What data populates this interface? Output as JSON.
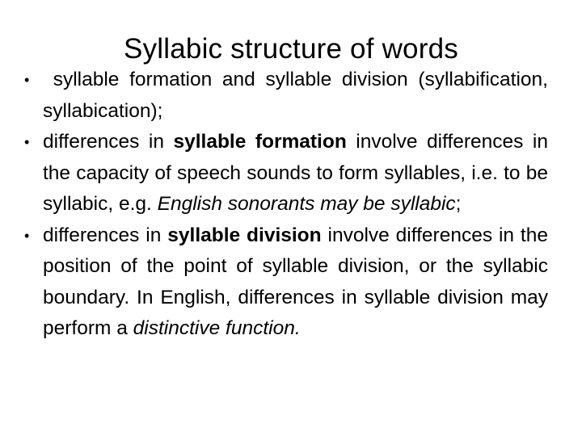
{
  "slide": {
    "title": "Syllabic structure of words",
    "bullets": [
      {
        "segments": [
          {
            "text": " syllable formation and syllable division (syllabification, syllabication);",
            "style": "normal"
          }
        ]
      },
      {
        "segments": [
          {
            "text": "differences in ",
            "style": "normal"
          },
          {
            "text": "syllable formation",
            "style": "bold"
          },
          {
            "text": " involve differences in the capacity of speech sounds to form syllables, i.e. to be syllabic, e.g. ",
            "style": "normal"
          },
          {
            "text": "English sonorants may be syllabic",
            "style": "italic"
          },
          {
            "text": ";",
            "style": "normal"
          }
        ]
      },
      {
        "segments": [
          {
            "text": "differences in ",
            "style": "normal"
          },
          {
            "text": "syllable division",
            "style": "bold"
          },
          {
            "text": " involve differences in the position of the point of syllable division, or the syllabic boundary. In English, differences in syllable division may perform a ",
            "style": "normal"
          },
          {
            "text": "distinctive function.",
            "style": "italic"
          }
        ]
      }
    ],
    "bullet_glyph": "•"
  }
}
